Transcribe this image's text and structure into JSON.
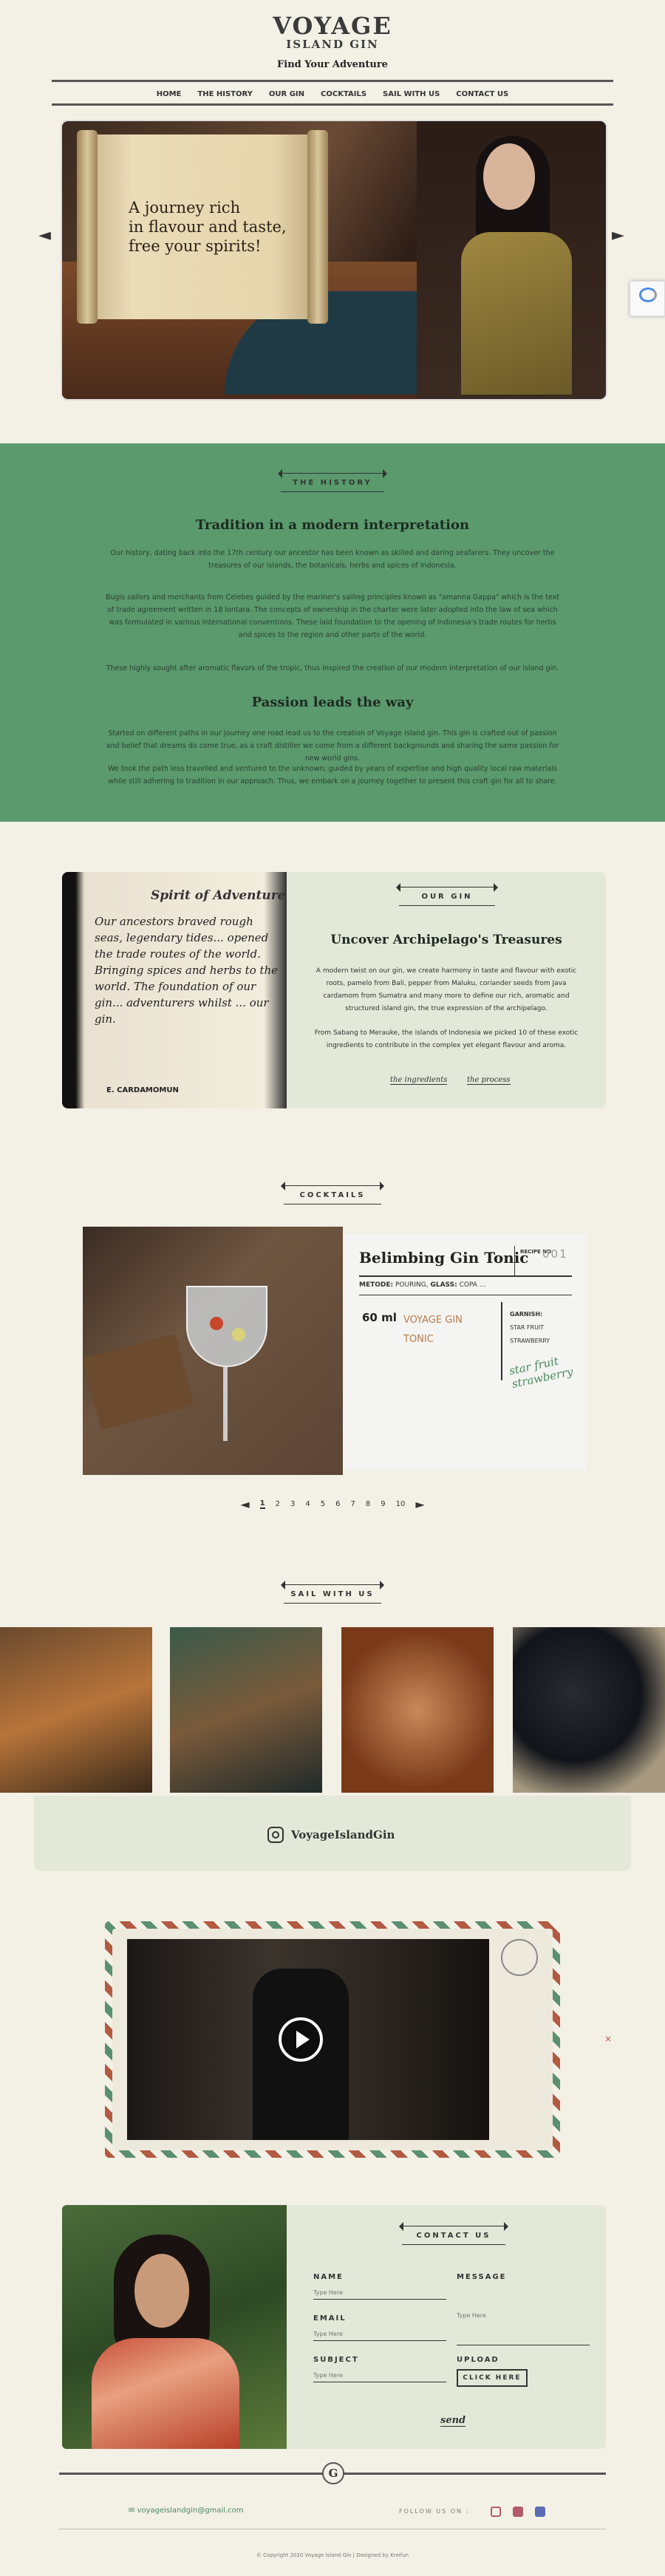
{
  "brand": {
    "line1": "VOYAGE",
    "line2": "ISLAND GIN",
    "tagline": "Find Your Adventure"
  },
  "nav": [
    "HOME",
    "THE HISTORY",
    "OUR GIN",
    "COCKTAILS",
    "SAIL WITH US",
    "CONTACT US"
  ],
  "hero": {
    "text_line1": "A journey rich",
    "text_line2": "in flavour and taste,",
    "text_line3": "free your spirits!"
  },
  "history": {
    "ribbon": "THE HISTORY",
    "h1": "Tradition in a modern interpretation",
    "p1": "Our history, dating back into the 17th century our ancestor has been known as skilled and daring seafarers. They uncover the treasures of our islands, the botanicals, herbs and spices of Indonesia.",
    "p2": "Bugis sailors and merchants from Celebes guided by the mariner's sailing principles known as \"amanna Gappa\" which is the text of trade agreement written in 18 lontara. The concepts of ownership in the charter were later adopted into the law of sea which was formulated in various international conventions. These laid foundation to the opening of Indonesia's trade routes for herbs and spices to the region and other parts of the world.",
    "p3": "These highly sought after aromatic flavors of the tropic, thus inspired the creation of our modern interpretation of our island gin.",
    "h2": "Passion leads the way",
    "p4": "Started on different paths in our journey one road lead us to the creation of Voyage Island gin. This gin is crafted out of passion and belief that dreams do come true, as a craft distiller we come from a different backgrounds and sharing the same passion for new world gins.",
    "p5": "We took the path less travelled and ventured to the unknown; guided by years of expertise and high quality local raw materials while still adhering to tradition in our approach. Thus, we embark on a journey together to present this craft gin for all to share."
  },
  "ourgin": {
    "ribbon": "OUR GIN",
    "title": "Uncover Archipelago's Treasures",
    "p1": "A modern twist on our gin, we create harmony in taste and flavour with exotic roots, pamelo from Bali, pepper from Maluku, coriander seeds from Java cardamom from Sumatra and many more to define our rich, aromatic and structured island gin, the true expression of the archipelago.",
    "p2": "From Sabang to Merauke, the islands of Indonesia we picked 10 of these exotic ingredients to contribute in the complex yet elegant flavour and aroma.",
    "link1": "the ingredients",
    "link2": "the process",
    "doc_title": "Spirit of Adventure",
    "doc_text": "Our ancestors braved rough seas, legendary tides... opened the trade routes of the world. Bringing spices and herbs to the world. The foundation of our gin... adventurers whilst ... our gin.",
    "doc_footer": "E. CARDAMOMUN"
  },
  "cocktails": {
    "ribbon": "COCKTAILS",
    "name": "Belimbing Gin Tonic",
    "recipe_label": "RECIPE NO.",
    "recipe_no": "001",
    "method_label": "METODE:",
    "method": "POURING,",
    "glass_label": "GLASS:",
    "glass": "COPA ...",
    "amount": "60 ml",
    "ingredient": "VOYAGE GIN TONIC",
    "garnish_label": "GARNISH:",
    "garnish1": "STAR FRUIT",
    "garnish2": "STRAWBERRY",
    "script": "star fruit strawberry",
    "pages": [
      "1",
      "2",
      "3",
      "4",
      "5",
      "6",
      "7",
      "8",
      "9",
      "10"
    ]
  },
  "sail": {
    "ribbon": "SAIL WITH US",
    "handle": "VoyageIslandGin"
  },
  "contact": {
    "ribbon": "CONTACT US",
    "name_label": "NAME",
    "name_ph": "Type Here",
    "email_label": "EMAIL",
    "email_ph": "Type Here",
    "subject_label": "SUBJECT",
    "subject_ph": "Type Here",
    "message_label": "MESSAGE",
    "message_ph": "Type Here",
    "upload_label": "UPLOAD",
    "upload_btn": "CLICK HERE",
    "send": "send"
  },
  "footer": {
    "email": "voyageislandgin@gmail.com",
    "follow": "FOLLOW US ON :",
    "copyright": "© Copyright 2020 Voyage Island Gin  |  Designed by Kreifun"
  },
  "colors": {
    "green": "#5a9a6d",
    "paper": "#f3f0e6",
    "card": "#e4e8d8",
    "accent": "#b77b4b"
  }
}
